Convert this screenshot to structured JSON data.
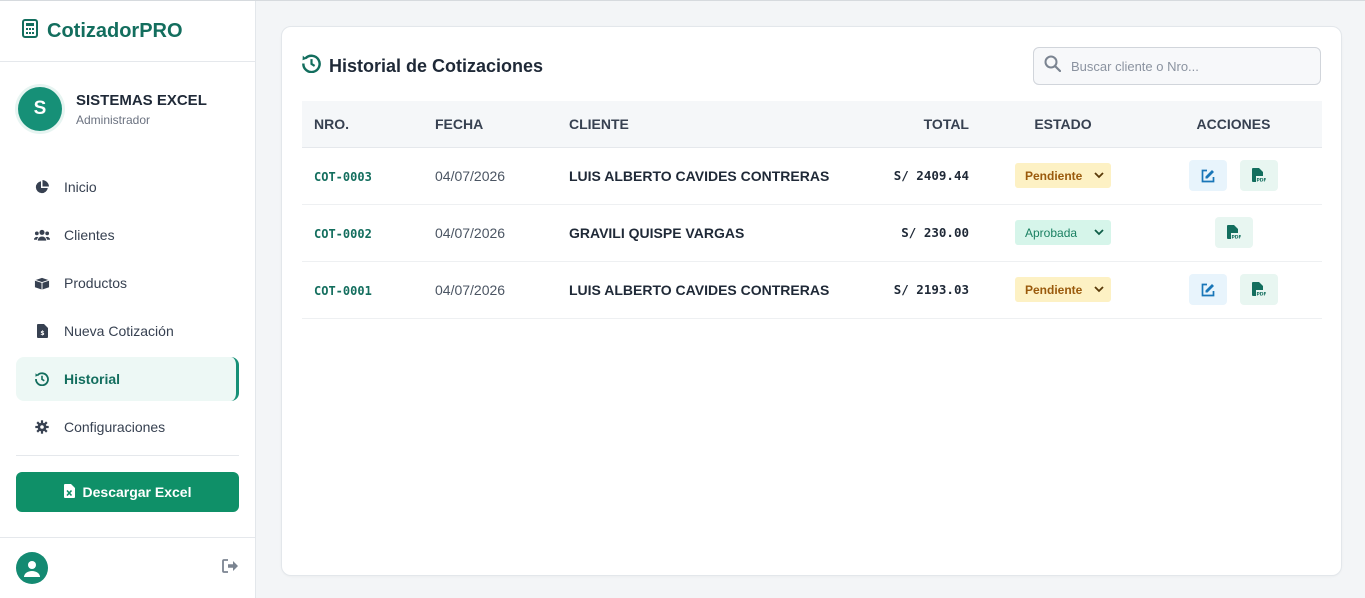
{
  "brand": {
    "name": "CotizadorPRO"
  },
  "user": {
    "initial": "S",
    "name": "SISTEMAS EXCEL",
    "role": "Administrador"
  },
  "nav": {
    "items": [
      {
        "label": "Inicio",
        "icon": "pie-chart-icon"
      },
      {
        "label": "Clientes",
        "icon": "users-icon"
      },
      {
        "label": "Productos",
        "icon": "boxes-icon"
      },
      {
        "label": "Nueva Cotización",
        "icon": "file-invoice-icon"
      },
      {
        "label": "Historial",
        "icon": "history-icon",
        "active": true
      },
      {
        "label": "Configuraciones",
        "icon": "gear-icon"
      }
    ]
  },
  "sidebar": {
    "excel_button": "Descargar Excel"
  },
  "main": {
    "title": "Historial de Cotizaciones",
    "search": {
      "placeholder": "Buscar cliente o Nro...",
      "value": ""
    },
    "table": {
      "headers": {
        "nro": "NRO.",
        "fecha": "FECHA",
        "cliente": "CLIENTE",
        "total": "TOTAL",
        "estado": "ESTADO",
        "acciones": "ACCIONES"
      },
      "rows": [
        {
          "nro": "COT-0003",
          "fecha": "04/07/2026",
          "cliente": "LUIS ALBERTO CAVIDES CONTRERAS",
          "total": "S/ 2409.44",
          "estado": "Pendiente",
          "actions": [
            "edit",
            "pdf"
          ]
        },
        {
          "nro": "COT-0002",
          "fecha": "04/07/2026",
          "cliente": "GRAVILI QUISPE VARGAS",
          "total": "S/ 230.00",
          "estado": "Aprobada",
          "actions": [
            "pdf"
          ]
        },
        {
          "nro": "COT-0001",
          "fecha": "04/07/2026",
          "cliente": "LUIS ALBERTO CAVIDES CONTRERAS",
          "total": "S/ 2193.03",
          "estado": "Pendiente",
          "actions": [
            "edit",
            "pdf"
          ]
        }
      ]
    }
  },
  "colors": {
    "brand": "#136e5e",
    "accent": "#169077",
    "excel_button": "#0f9068",
    "pending_bg": "#fdf1c4",
    "approved_bg": "#d6f5ea"
  }
}
